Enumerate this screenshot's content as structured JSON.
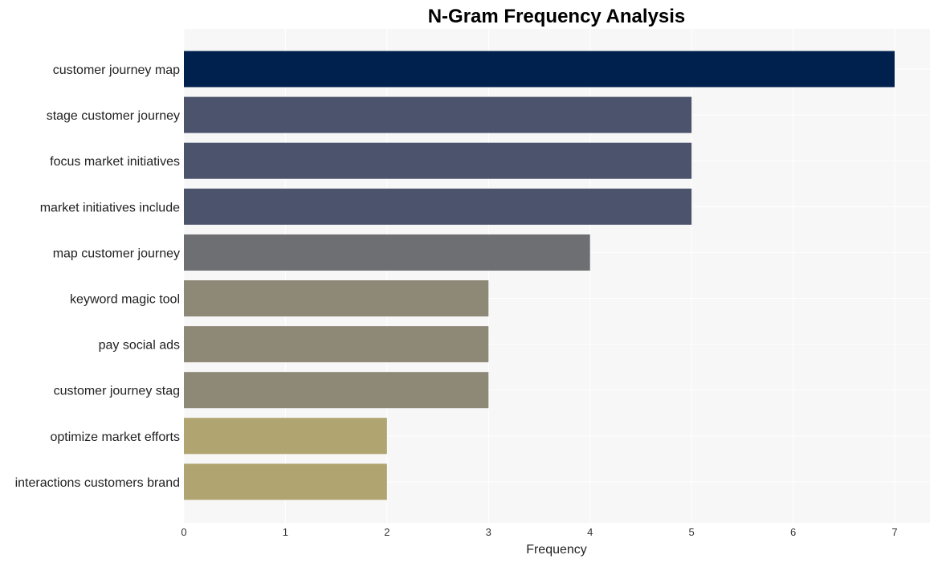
{
  "chart_data": {
    "type": "bar",
    "orientation": "horizontal",
    "title": "N-Gram Frequency Analysis",
    "xlabel": "Frequency",
    "ylabel": "",
    "xlim": [
      0,
      7.35
    ],
    "xticks": [
      0,
      1,
      2,
      3,
      4,
      5,
      6,
      7
    ],
    "grid": true,
    "categories": [
      "customer journey map",
      "stage customer journey",
      "focus market initiatives",
      "market initiatives include",
      "map customer journey",
      "keyword magic tool",
      "pay social ads",
      "customer journey stag",
      "optimize market efforts",
      "interactions customers brand"
    ],
    "values": [
      7,
      5,
      5,
      5,
      4,
      3,
      3,
      3,
      2,
      2
    ],
    "colors": [
      "#00214e",
      "#4b546c",
      "#4b546c",
      "#4b546c",
      "#6e6f73",
      "#8e8877",
      "#8e8877",
      "#8e8877",
      "#b0a570",
      "#b0a570"
    ],
    "plot_background": "#f7f7f7",
    "grid_color": "#ffffff"
  }
}
